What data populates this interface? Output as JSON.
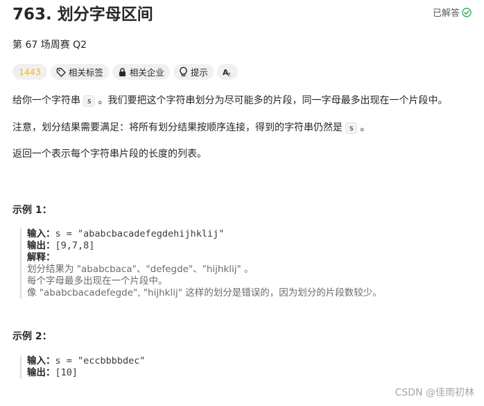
{
  "problem": {
    "title": "763. 划分字母区间",
    "solved_label": "已解答",
    "contest": "第 67 场周赛 Q2"
  },
  "tags": {
    "difficulty": "1443",
    "related_tags": "相关标签",
    "related_companies": "相关企业",
    "hint": "提示"
  },
  "description": {
    "p1_before": "给你一个字符串",
    "p1_code": "s",
    "p1_after": "。我们要把这个字符串划分为尽可能多的片段，同一字母最多出现在一个片段中。",
    "p2_before": "注意，划分结果需要满足：将所有划分结果按顺序连接，得到的字符串仍然是",
    "p2_code": "s",
    "p2_after": "。",
    "p3": "返回一个表示每个字符串片段的长度的列表。"
  },
  "example1": {
    "heading": "示例 1：",
    "input_label": "输入：",
    "input_value": "s = \"ababcbacadefegdehijhklij\"",
    "output_label": "输出：",
    "output_value": "[9,7,8]",
    "explain_label": "解释：",
    "explain1": "划分结果为 \"ababcbaca\"、\"defegde\"、\"hijhklij\" 。",
    "explain2": "每个字母最多出现在一个片段中。",
    "explain3": "像 \"ababcbacadefegde\", \"hijhklij\" 这样的划分是错误的，因为划分的片段数较少。"
  },
  "example2": {
    "heading": "示例 2：",
    "input_label": "输入：",
    "input_value": "s = \"eccbbbbdec\"",
    "output_label": "输出：",
    "output_value": "[10]"
  },
  "watermark": "CSDN @佳雨初林",
  "colors": {
    "difficulty": "#ffb800",
    "solved_check": "#2db55d"
  }
}
